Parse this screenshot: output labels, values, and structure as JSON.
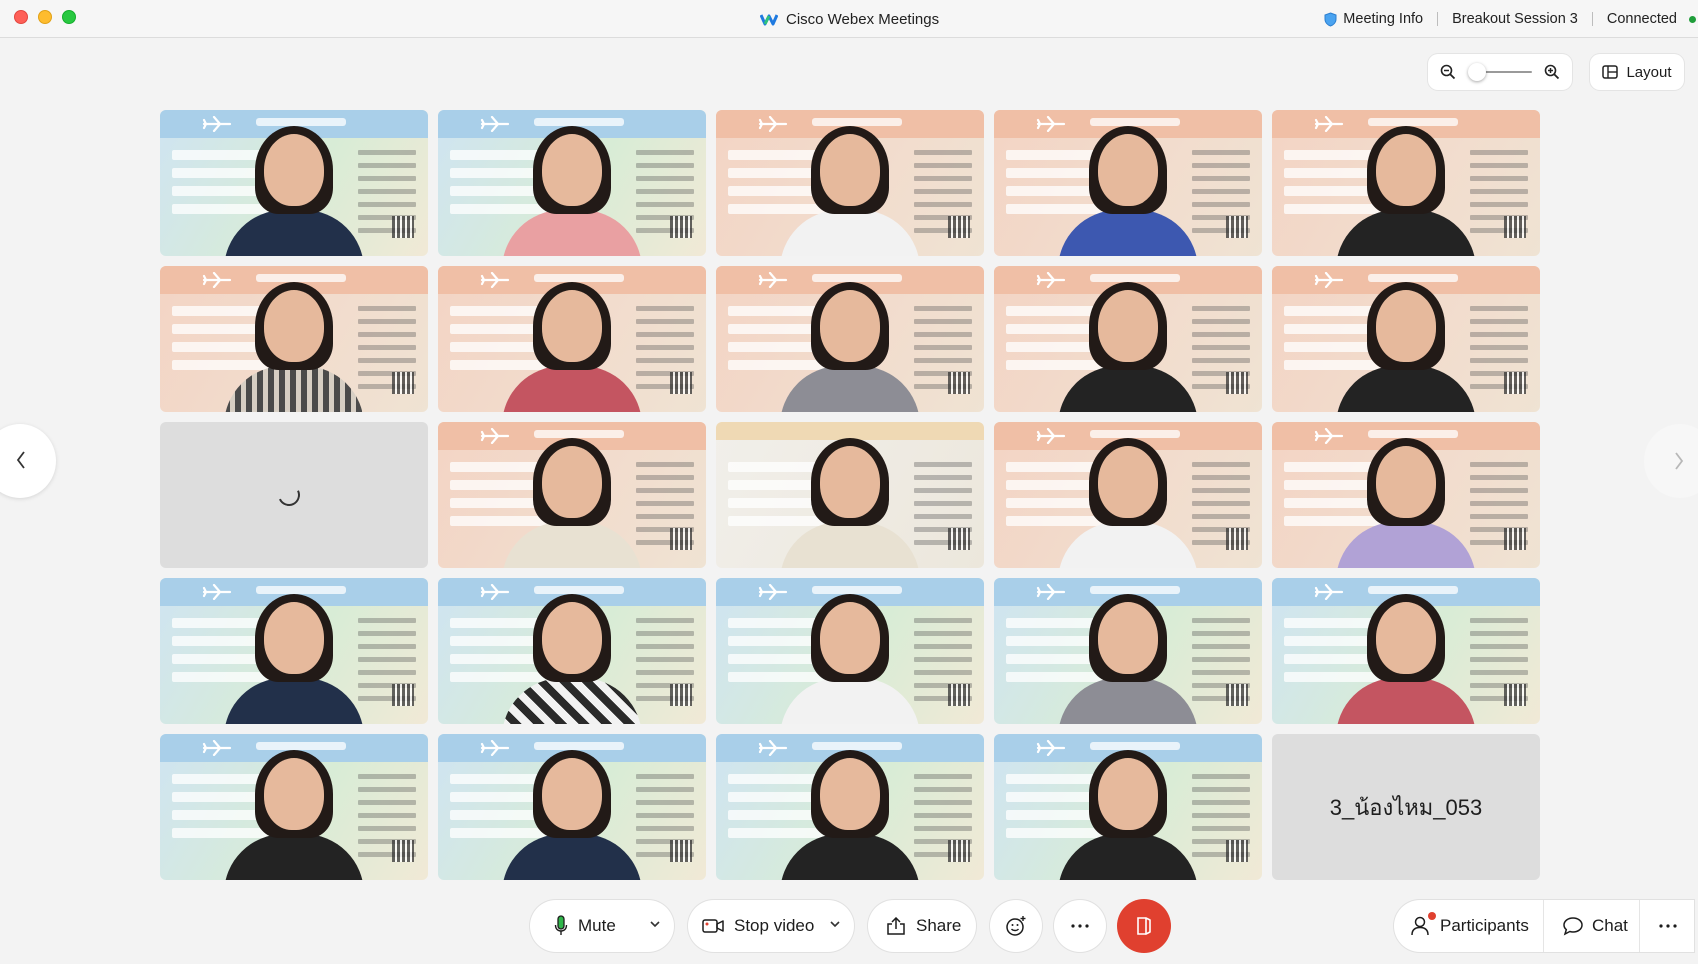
{
  "window": {
    "title": "Cisco Webex Meetings",
    "meeting_info": "Meeting Info",
    "session": "Breakout Session 3",
    "status": "Connected",
    "status_color": "#1f9d3a"
  },
  "view_controls": {
    "zoom_out_icon": "zoom-out-icon",
    "zoom_in_icon": "zoom-in-icon",
    "zoom_level": 0,
    "layout_label": "Layout"
  },
  "grid": {
    "columns": 5,
    "rows": 5,
    "tiles": [
      {
        "type": "video",
        "bg": "blue",
        "shirt": "navy"
      },
      {
        "type": "video",
        "bg": "blue",
        "shirt": "pink"
      },
      {
        "type": "video",
        "bg": "peach",
        "shirt": "white"
      },
      {
        "type": "video",
        "bg": "peach",
        "shirt": "blue"
      },
      {
        "type": "video",
        "bg": "peach",
        "shirt": "black"
      },
      {
        "type": "video",
        "bg": "peach",
        "shirt": "stripe"
      },
      {
        "type": "video",
        "bg": "peach",
        "shirt": "red"
      },
      {
        "type": "video",
        "bg": "peach",
        "shirt": "grey"
      },
      {
        "type": "video",
        "bg": "peach",
        "shirt": "black"
      },
      {
        "type": "video",
        "bg": "peach",
        "shirt": "black"
      },
      {
        "type": "loading"
      },
      {
        "type": "video",
        "bg": "peach",
        "shirt": "cream"
      },
      {
        "type": "video",
        "bg": "plain",
        "shirt": "cream"
      },
      {
        "type": "video",
        "bg": "peach",
        "shirt": "white"
      },
      {
        "type": "video",
        "bg": "peach",
        "shirt": "purple"
      },
      {
        "type": "video",
        "bg": "blue",
        "shirt": "navy"
      },
      {
        "type": "video",
        "bg": "blue",
        "shirt": "pattern"
      },
      {
        "type": "video",
        "bg": "blue",
        "shirt": "white"
      },
      {
        "type": "video",
        "bg": "blue",
        "shirt": "grey"
      },
      {
        "type": "video",
        "bg": "blue",
        "shirt": "red"
      },
      {
        "type": "video",
        "bg": "blue",
        "shirt": "black"
      },
      {
        "type": "video",
        "bg": "blue",
        "shirt": "navy"
      },
      {
        "type": "video",
        "bg": "blue",
        "shirt": "black"
      },
      {
        "type": "video",
        "bg": "blue",
        "shirt": "black"
      },
      {
        "type": "name",
        "label": "3_น้องไหม_053"
      }
    ]
  },
  "controls": {
    "mute": "Mute",
    "stop_video": "Stop video",
    "share": "Share",
    "participants": "Participants",
    "chat": "Chat",
    "leave_color": "#e0402f"
  }
}
